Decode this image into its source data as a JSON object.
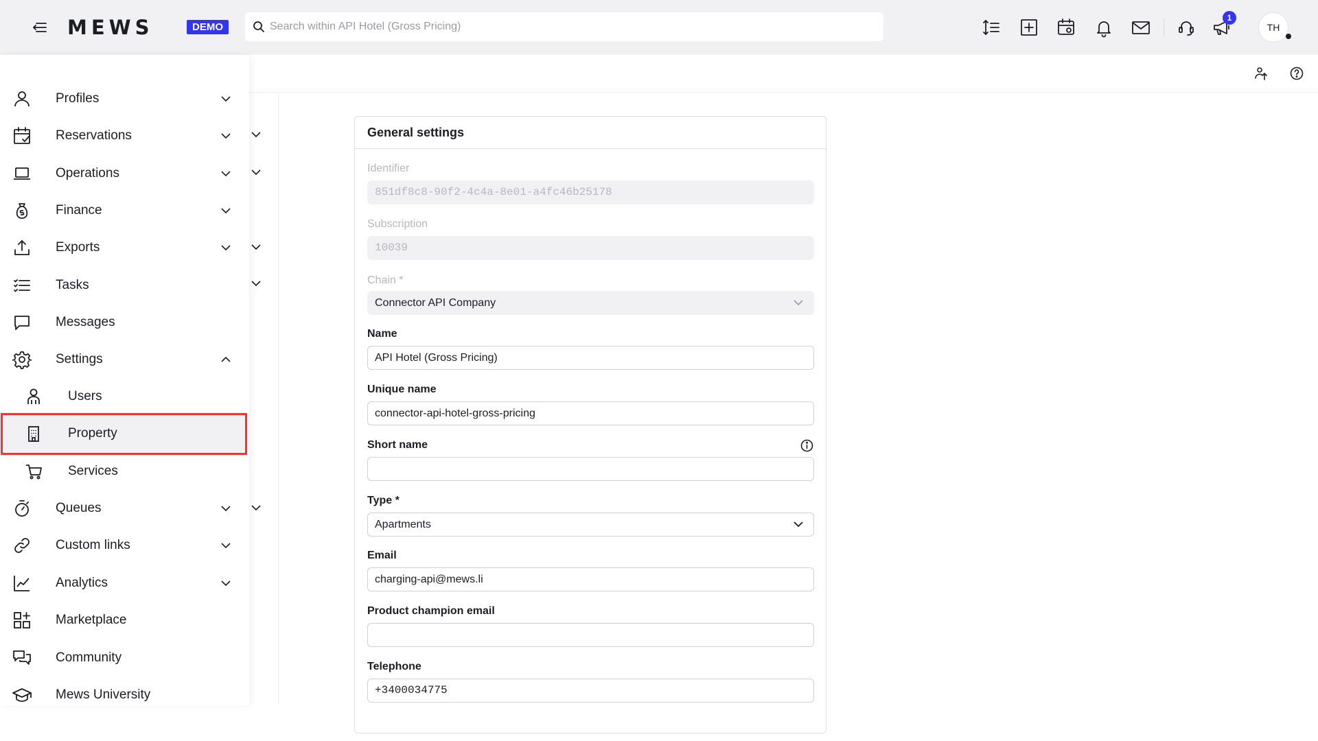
{
  "topbar": {
    "logo": "MEWS",
    "demo_badge": "DEMO",
    "search_placeholder": "Search within API Hotel (Gross Pricing)",
    "notification_count": "1",
    "avatar_initials": "TH"
  },
  "sidebar": {
    "items": [
      {
        "label": "Profiles",
        "icon": "user-icon",
        "chevron": "down"
      },
      {
        "label": "Reservations",
        "icon": "calendar-check-icon",
        "chevron": "down"
      },
      {
        "label": "Operations",
        "icon": "laptop-icon",
        "chevron": "down"
      },
      {
        "label": "Finance",
        "icon": "money-bag-icon",
        "chevron": "down"
      },
      {
        "label": "Exports",
        "icon": "upload-icon",
        "chevron": "down"
      },
      {
        "label": "Tasks",
        "icon": "checklist-icon",
        "chevron": "none"
      },
      {
        "label": "Messages",
        "icon": "chat-bubble-icon",
        "chevron": "none"
      },
      {
        "label": "Settings",
        "icon": "gear-icon",
        "chevron": "up"
      },
      {
        "label": "Users",
        "icon": "users-icon",
        "chevron": "none"
      },
      {
        "label": "Property",
        "icon": "building-icon",
        "chevron": "none"
      },
      {
        "label": "Services",
        "icon": "cart-icon",
        "chevron": "none"
      },
      {
        "label": "Queues",
        "icon": "stopwatch-icon",
        "chevron": "down"
      },
      {
        "label": "Custom links",
        "icon": "link-icon",
        "chevron": "down"
      },
      {
        "label": "Analytics",
        "icon": "line-chart-icon",
        "chevron": "down"
      },
      {
        "label": "Marketplace",
        "icon": "apps-add-icon",
        "chevron": "none"
      },
      {
        "label": "Community",
        "icon": "conversation-icon",
        "chevron": "none"
      },
      {
        "label": "Mews University",
        "icon": "graduation-cap-icon",
        "chevron": "none"
      }
    ],
    "selected": "Property",
    "highlight_color": "#e53935"
  },
  "form": {
    "title": "General settings",
    "identifier": {
      "label": "Identifier",
      "value": "851df8c8-90f2-4c4a-8e01-a4fc46b25178"
    },
    "subscription": {
      "label": "Subscription",
      "value": "10039"
    },
    "chain": {
      "label": "Chain *",
      "value": "Connector API Company"
    },
    "name": {
      "label": "Name",
      "value": "API Hotel (Gross Pricing)"
    },
    "unique_name": {
      "label": "Unique name",
      "value": "connector-api-hotel-gross-pricing"
    },
    "short_name": {
      "label": "Short name",
      "value": ""
    },
    "type": {
      "label": "Type *",
      "value": "Apartments"
    },
    "email": {
      "label": "Email",
      "value": "charging-api@mews.li"
    },
    "product_champion_email": {
      "label": "Product champion email",
      "value": ""
    },
    "telephone": {
      "label": "Telephone",
      "value": "+3400034775"
    }
  },
  "colors": {
    "accent": "#3434f5",
    "topbar_bg": "#f1f1f3",
    "text": "#1c1d24"
  }
}
